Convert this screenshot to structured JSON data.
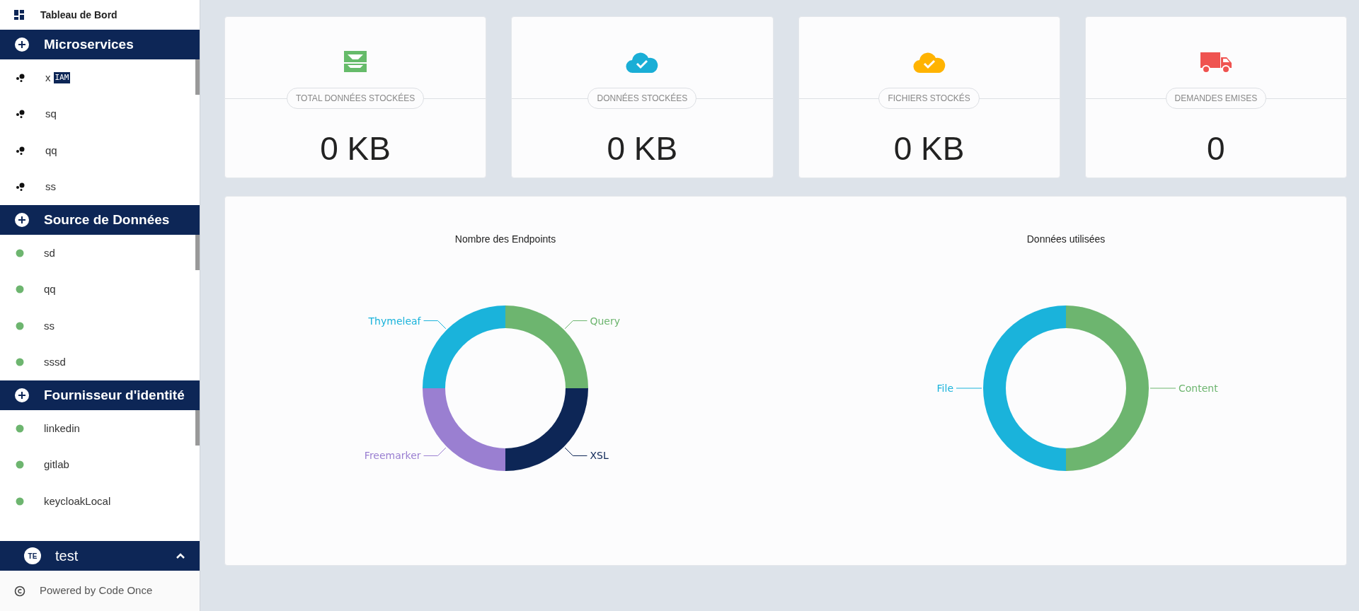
{
  "sidebar": {
    "top_item": {
      "label": "Tableau de Bord"
    },
    "sections": [
      {
        "title": "Microservices",
        "kind": "services",
        "items": [
          {
            "label": "x",
            "badge": "IAM"
          },
          {
            "label": "sq"
          },
          {
            "label": "qq"
          },
          {
            "label": "ss"
          }
        ]
      },
      {
        "title": "Source de Données",
        "kind": "sources",
        "items": [
          {
            "label": "sd"
          },
          {
            "label": "qq"
          },
          {
            "label": "ss"
          },
          {
            "label": "sssd"
          }
        ]
      },
      {
        "title": "Fournisseur d'identité",
        "kind": "sources",
        "items": [
          {
            "label": "linkedin"
          },
          {
            "label": "gitlab"
          },
          {
            "label": "keycloakLocal"
          }
        ]
      }
    ],
    "user": {
      "initials": "TE",
      "name": "test",
      "expanded": true
    },
    "footer": "Powered by Code Once"
  },
  "cards": [
    {
      "kind": "inbox",
      "color": "#66bb6a",
      "label": "TOTAL DONNÉES STOCKÉES",
      "value": "0 KB"
    },
    {
      "kind": "cloud",
      "color": "#1aaed6",
      "label": "DONNÉES STOCKÉES",
      "value": "0 KB"
    },
    {
      "kind": "cloud",
      "color": "#ffb300",
      "label": "FICHIERS STOCKÉS",
      "value": "0 KB"
    },
    {
      "kind": "truck",
      "color": "#ef5350",
      "label": "DEMANDES EMISES",
      "value": "0"
    }
  ],
  "charts": [
    {
      "chart_data": {
        "type": "donut",
        "title": "Nombre des Endpoints",
        "categories": [
          "Query",
          "XSL",
          "Freemarker",
          "Thymeleaf"
        ],
        "values": [
          25,
          25,
          25,
          25
        ],
        "colors": [
          "#6db56f",
          "#0d2656",
          "#9a7fd1",
          "#1ab3db"
        ]
      }
    },
    {
      "chart_data": {
        "type": "donut",
        "title": "Données utilisées",
        "categories": [
          "Content",
          "File"
        ],
        "values": [
          50,
          50
        ],
        "colors": [
          "#6db56f",
          "#1ab3db"
        ]
      }
    }
  ]
}
